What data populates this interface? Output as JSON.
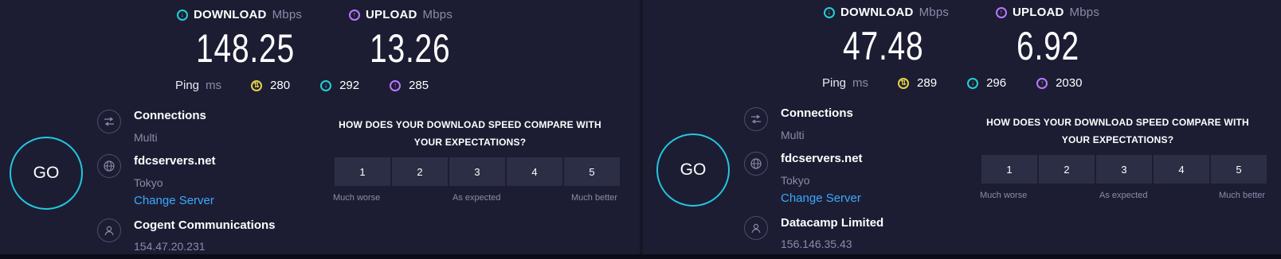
{
  "panels": [
    {
      "download": {
        "label": "DOWNLOAD",
        "unit": "Mbps",
        "value": "148.25"
      },
      "upload": {
        "label": "UPLOAD",
        "unit": "Mbps",
        "value": "13.26"
      },
      "ping": {
        "label": "Ping",
        "unit": "ms",
        "idle": "280",
        "download": "292",
        "upload": "285"
      },
      "go_label": "GO",
      "connections": {
        "title": "Connections",
        "value": "Multi"
      },
      "server": {
        "title": "fdcservers.net",
        "location": "Tokyo",
        "change_label": "Change Server"
      },
      "isp": {
        "title": "Cogent Communications",
        "ip": "154.47.20.231"
      },
      "survey": {
        "question_line1": "HOW DOES YOUR DOWNLOAD SPEED COMPARE WITH",
        "question_line2": "YOUR EXPECTATIONS?",
        "options": [
          "1",
          "2",
          "3",
          "4",
          "5"
        ],
        "low_label": "Much worse",
        "mid_label": "As expected",
        "high_label": "Much better"
      }
    },
    {
      "download": {
        "label": "DOWNLOAD",
        "unit": "Mbps",
        "value": "47.48"
      },
      "upload": {
        "label": "UPLOAD",
        "unit": "Mbps",
        "value": "6.92"
      },
      "ping": {
        "label": "Ping",
        "unit": "ms",
        "idle": "289",
        "download": "296",
        "upload": "2030"
      },
      "go_label": "GO",
      "connections": {
        "title": "Connections",
        "value": "Multi"
      },
      "server": {
        "title": "fdcservers.net",
        "location": "Tokyo",
        "change_label": "Change Server"
      },
      "isp": {
        "title": "Datacamp Limited",
        "ip": "156.146.35.43"
      },
      "survey": {
        "question_line1": "HOW DOES YOUR DOWNLOAD SPEED COMPARE WITH",
        "question_line2": "YOUR EXPECTATIONS?",
        "options": [
          "1",
          "2",
          "3",
          "4",
          "5"
        ],
        "low_label": "Much worse",
        "mid_label": "As expected",
        "high_label": "Much better"
      }
    }
  ],
  "colors": {
    "download_accent": "#23d0d2",
    "upload_accent": "#bb78ff",
    "ping_accent": "#e6d247",
    "link": "#3ea8ff",
    "go_ring": "#23c8e0",
    "background": "#1c1d33"
  }
}
